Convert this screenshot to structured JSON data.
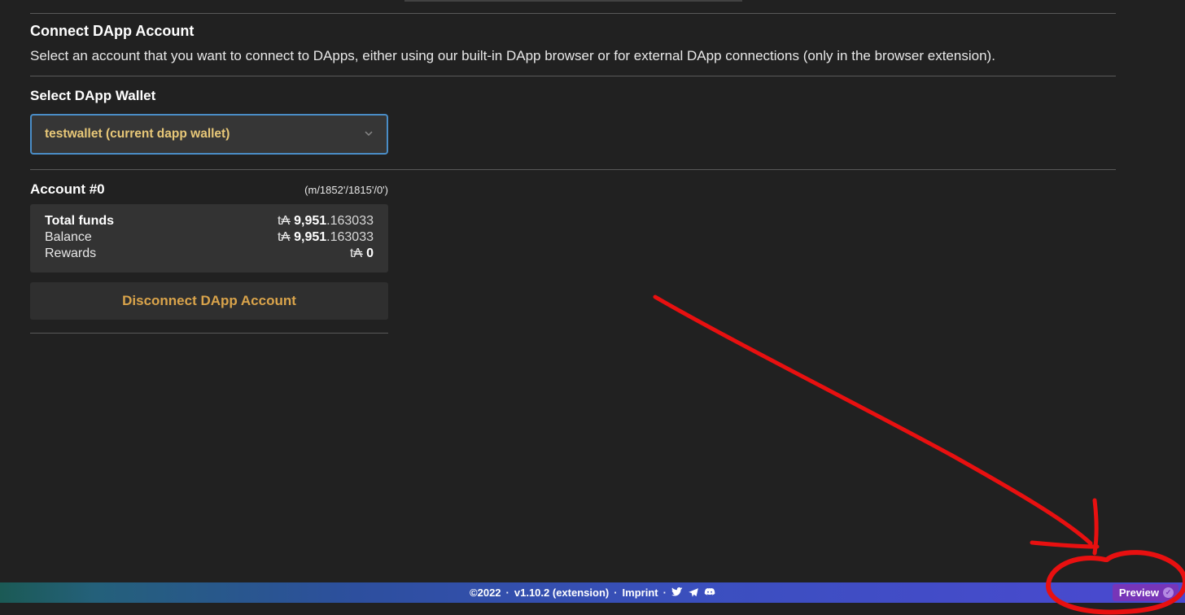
{
  "section": {
    "title": "Connect DApp Account",
    "description": "Select an account that you want to connect to DApps, either using our built-in DApp browser or for external DApp connections (only in the browser extension).",
    "select_label": "Select DApp Wallet"
  },
  "wallet_select": {
    "value": "testwallet (current dapp wallet)"
  },
  "account": {
    "title": "Account #0",
    "path": "(m/1852'/1815'/0')",
    "currency": "t₳",
    "rows": [
      {
        "label": "Total funds",
        "bold": true,
        "major": "9,951",
        "minor": ".163033"
      },
      {
        "label": "Balance",
        "bold": false,
        "major": "9,951",
        "minor": ".163033"
      },
      {
        "label": "Rewards",
        "bold": false,
        "major": "0",
        "minor": ""
      }
    ]
  },
  "actions": {
    "disconnect": "Disconnect DApp Account"
  },
  "footer": {
    "copyright": "©2022",
    "version": "v1.10.2 (extension)",
    "imprint": "Imprint",
    "preview": "Preview"
  }
}
